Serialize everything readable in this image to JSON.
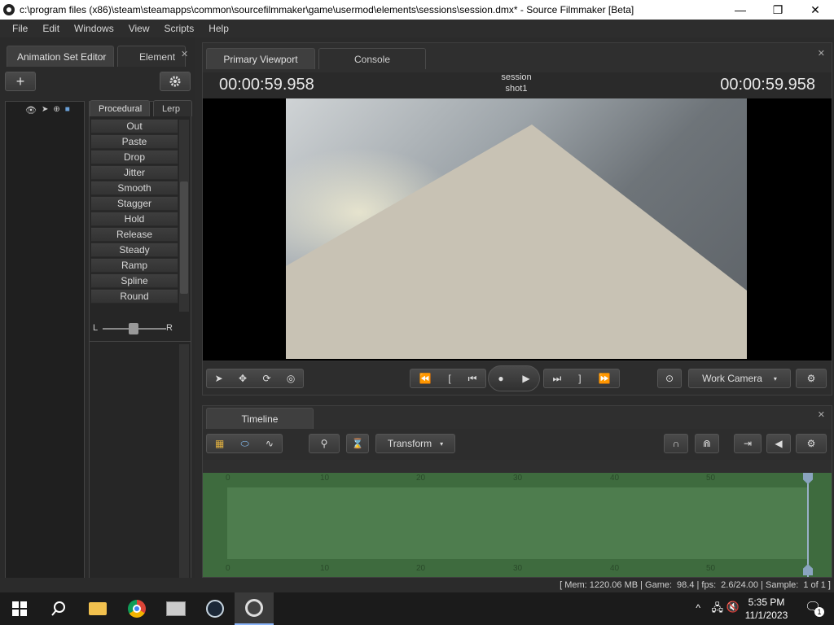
{
  "window": {
    "title": "c:\\program files (x86)\\steam\\steamapps\\common\\sourcefilmmaker\\game\\usermod\\elements\\sessions\\session.dmx* - Source Filmmaker [Beta]",
    "minimize": "—",
    "maximize": "❐",
    "close": "✕"
  },
  "menu": [
    "File",
    "Edit",
    "Windows",
    "View",
    "Scripts",
    "Help"
  ],
  "left": {
    "tabs": [
      "Animation Set Editor",
      "Element"
    ],
    "add_label": "+",
    "proc_tabs": [
      "Procedural",
      "Lerp"
    ],
    "procedures": [
      "Out",
      "Paste",
      "Drop",
      "Jitter",
      "Smooth",
      "Stagger",
      "Hold",
      "Release",
      "Steady",
      "Ramp",
      "Spline",
      "Round"
    ],
    "slider_left": "L",
    "slider_right": "R"
  },
  "viewport": {
    "tabs": [
      "Primary Viewport",
      "Console"
    ],
    "timecode_left": "00:00:59.958",
    "timecode_right": "00:00:59.958",
    "session": "session",
    "shot": "shot1",
    "camera_label": "Work Camera"
  },
  "timeline": {
    "tab": "Timeline",
    "mode_label": "Transform",
    "ticks_top": [
      "0",
      "10",
      "20",
      "30",
      "40",
      "50"
    ],
    "ticks_bottom": [
      "0",
      "10",
      "20",
      "30",
      "40",
      "50"
    ]
  },
  "status": {
    "mem": "[ Mem:  1220.06 MB | Game:",
    "game_val": "98.4 | fps:",
    "fps_val": "2.6/24.00 | Sample:",
    "sample_val": "1 of 1 ]"
  },
  "taskbar": {
    "time": "5:35 PM",
    "date": "11/1/2023",
    "notif_count": "1"
  }
}
